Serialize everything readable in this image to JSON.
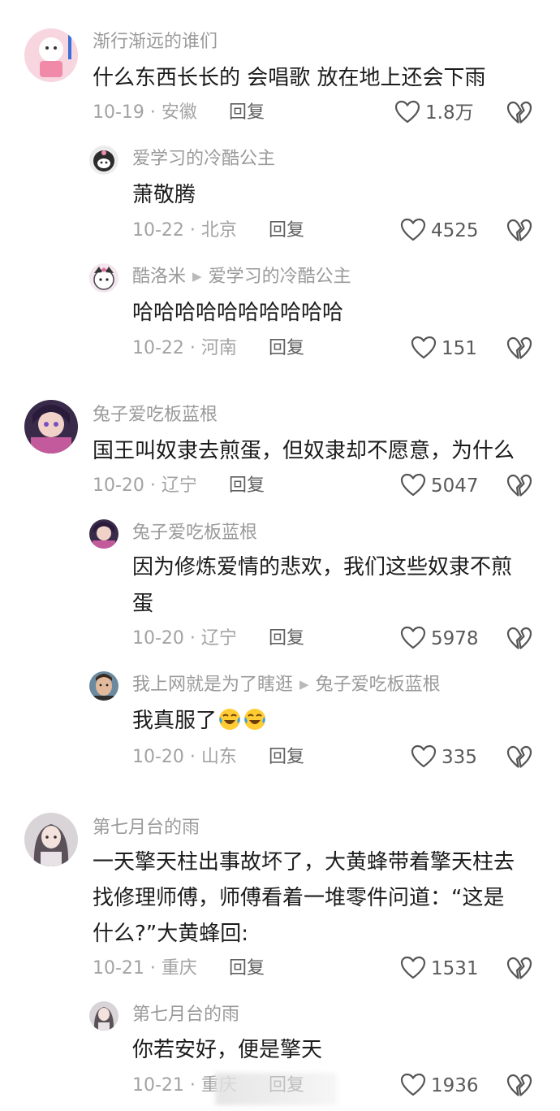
{
  "icons": {
    "like": "heart-outline-icon",
    "dislike": "broken-heart-icon",
    "arrow": "caret-right-icon",
    "emoji": "crying-laughing-emoji"
  },
  "colors": {
    "text": "#1c1c1c",
    "name": "#9a9a9a",
    "meta": "#a3a3a3"
  },
  "comments": [
    {
      "user": "渐行渐远的谁们",
      "text": "什么东西长长的 会唱歌 放在地上还会下雨",
      "date_loc": "10-19 · 安徽",
      "reply": "回复",
      "likes": "1.8万"
    },
    {
      "user": "爱学习的冷酷公主",
      "text": "萧敬腾",
      "date_loc": "10-22 · 北京",
      "reply": "回复",
      "likes": "4525"
    },
    {
      "user": "酷洛米",
      "reply_to": "爱学习的冷酷公主",
      "text": "哈哈哈哈哈哈哈哈哈哈",
      "date_loc": "10-22 · 河南",
      "reply": "回复",
      "likes": "151"
    },
    {
      "user": "兔子爱吃板蓝根",
      "text": "国王叫奴隶去煎蛋，但奴隶却不愿意，为什么",
      "date_loc": "10-20 · 辽宁",
      "reply": "回复",
      "likes": "5047"
    },
    {
      "user": "兔子爱吃板蓝根",
      "text_line1": "因为修炼爱情的悲欢，我们这些奴隶不煎",
      "text_line2": "蛋",
      "date_loc": "10-20 · 辽宁",
      "reply": "回复",
      "likes": "5978"
    },
    {
      "user": "我上网就是为了瞎逛",
      "reply_to": "兔子爱吃板蓝根",
      "text": "我真服了",
      "date_loc": "10-20 · 山东",
      "reply": "回复",
      "likes": "335"
    },
    {
      "user": "第七月台的雨",
      "text_line1": "一天擎天柱出事故坏了，大黄蜂带着擎天柱去",
      "text_line2": "找修理师傅，师傅看着一堆零件问道：“这是",
      "text_line3": "什么?”大黄蜂回:",
      "date_loc": "10-21 · 重庆",
      "reply": "回复",
      "likes": "1531"
    },
    {
      "user": "第七月台的雨",
      "text": "你若安好，便是擎天",
      "date_loc": "10-21 · 重庆",
      "reply": "回复",
      "likes": "1936"
    }
  ]
}
